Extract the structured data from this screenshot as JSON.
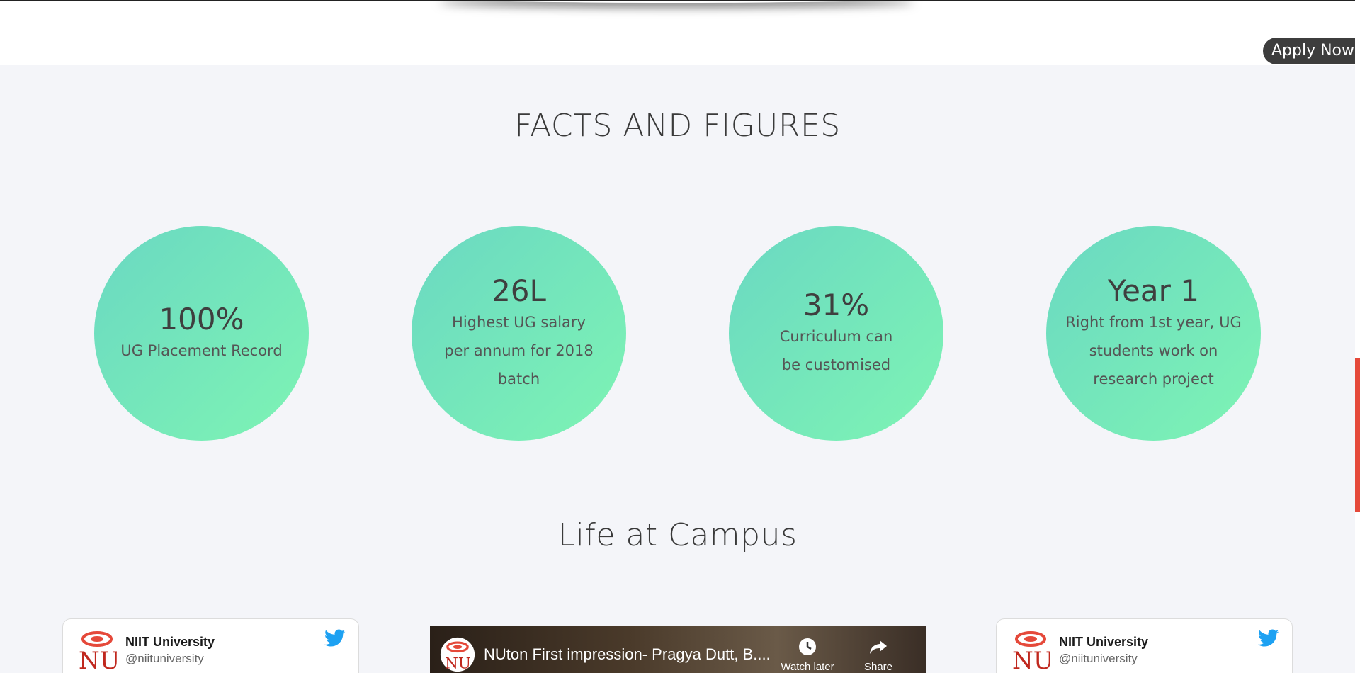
{
  "apply_button": {
    "label": "Apply Now"
  },
  "facts": {
    "title": "FACTS AND FIGURES",
    "items": [
      {
        "value": "100%",
        "label": "UG Placement Record"
      },
      {
        "value": "26L",
        "label": "Highest UG salary per annum for 2018 batch"
      },
      {
        "value": "31%",
        "label": "Curriculum can be customised"
      },
      {
        "value": "Year 1",
        "label": "Right from 1st year, UG students work on research project"
      }
    ]
  },
  "campus": {
    "title": "Life at Campus",
    "tweets": [
      {
        "name": "NIIT University",
        "handle": "@niituniversity"
      },
      {
        "name": "NIIT University",
        "handle": "@niituniversity"
      }
    ],
    "video": {
      "title": "NUton First impression- Pragya Dutt, B....",
      "watch_later_label": "Watch later",
      "share_label": "Share"
    }
  },
  "colors": {
    "circle_gradient_start": "#6ad8c2",
    "circle_gradient_end": "#7ef4b4",
    "apply_bg": "#3d3d3d",
    "scroll_thumb": "#e5493a",
    "twitter_blue": "#1da1f2",
    "logo_red": "#c0281e"
  },
  "icons": {
    "twitter": "twitter-bird-icon",
    "watch_later": "clock-icon",
    "share": "share-arrow-icon",
    "logo": "nu-logo"
  }
}
